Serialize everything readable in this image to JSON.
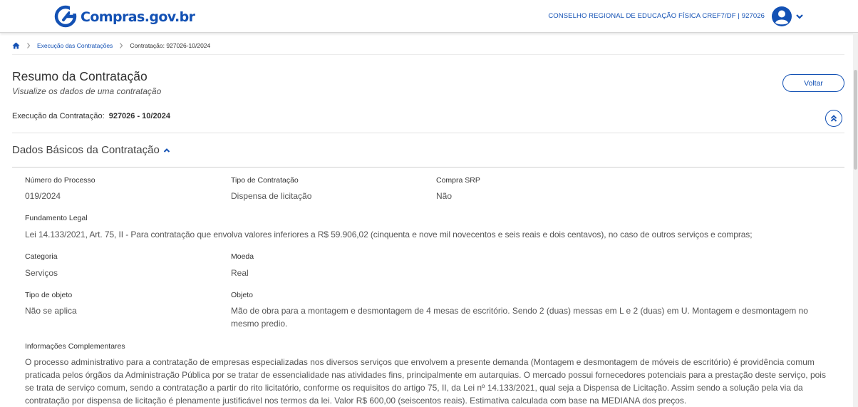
{
  "header": {
    "logo_text": "Compras.gov.br",
    "org_name": "CONSELHO REGIONAL DE EDUCAÇÃO FÍSICA CREF7/DF | 927026",
    "brand_color": "#1351b4"
  },
  "breadcrumb": {
    "items": [
      "Execução das Contratações",
      "Contratação: 927026-10/2024"
    ]
  },
  "page": {
    "title": "Resumo da Contratação",
    "subtitle": "Visualize os dados de uma contratação",
    "back_button": "Voltar",
    "exec_label": "Execução da Contratação:",
    "exec_value": "927026 - 10/2024"
  },
  "section": {
    "title": "Dados Básicos da Contratação"
  },
  "fields": {
    "numero_processo": {
      "label": "Número do Processo",
      "value": "019/2024"
    },
    "tipo_contratacao": {
      "label": "Tipo de Contratação",
      "value": "Dispensa de licitação"
    },
    "compra_srp": {
      "label": "Compra SRP",
      "value": "Não"
    },
    "fundamento_legal": {
      "label": "Fundamento Legal",
      "value": "Lei 14.133/2021, Art. 75, II - Para contratação que envolva valores inferiores a R$ 59.906,02 (cinquenta e nove mil novecentos e seis reais e dois centavos), no caso de outros serviços e compras;"
    },
    "categoria": {
      "label": "Categoria",
      "value": "Serviços"
    },
    "moeda": {
      "label": "Moeda",
      "value": "Real"
    },
    "tipo_objeto": {
      "label": "Tipo de objeto",
      "value": "Não se aplica"
    },
    "objeto": {
      "label": "Objeto",
      "value": "Mão de obra para a montagem e desmontagem de 4 mesas de escritório. Sendo 2 (duas) messas em L e 2 (duas) em U. Montagem e desmontagem no mesmo predio."
    },
    "info_complementares": {
      "label": "Informações Complementares",
      "value": "O processo administrativo para a contratação de empresas especializadas nos diversos serviços que envolvem a presente demanda (Montagem e desmontagem de móveis de escritório) é providência comum praticada pelos órgãos da Administração Pública por se tratar de essencialidade nas atividades fins, principalmente em autarquias. O mercado possui fornecedores potenciais para a prestação deste serviço, pois se trata de serviço comum, sendo a contratação a partir do rito licitatório, conforme os requisitos do artigo 75, II, da Lei nº 14.133/2021, qual seja a Dispensa de Licitação. Assim sendo a solução pela via da contratação por dispensa de licitação é plenamente justificável nos termos da lei. Valor R$ 600,00 (seiscentos reais). Estimativa calculada com base na MEDIANA dos preços."
    }
  }
}
